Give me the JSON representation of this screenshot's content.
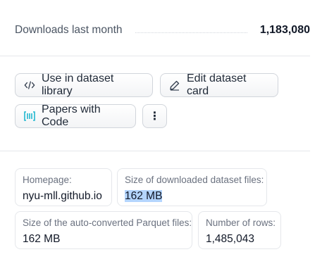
{
  "downloads": {
    "label": "Downloads last month",
    "value": "1,183,080"
  },
  "actions": {
    "use_in_library": "Use in dataset library",
    "edit_card": "Edit dataset card",
    "papers_with_code": "Papers with Code",
    "more": "⋮"
  },
  "info": {
    "homepage": {
      "label": "Homepage:",
      "value": "nyu-mll.github.io"
    },
    "download_size": {
      "label": "Size of downloaded dataset files:",
      "value": "162 MB"
    },
    "parquet_size": {
      "label": "Size of the auto-converted Parquet files:",
      "value": "162 MB"
    },
    "rows": {
      "label": "Number of rows:",
      "value": "1,485,043"
    }
  },
  "colors": {
    "papers_icon": "#22b8cf",
    "selection": "#b4d5fe",
    "border": "#d1d5db"
  },
  "icons": [
    "code-icon",
    "pencil-icon",
    "papers-with-code-icon",
    "more-vertical-icon"
  ]
}
